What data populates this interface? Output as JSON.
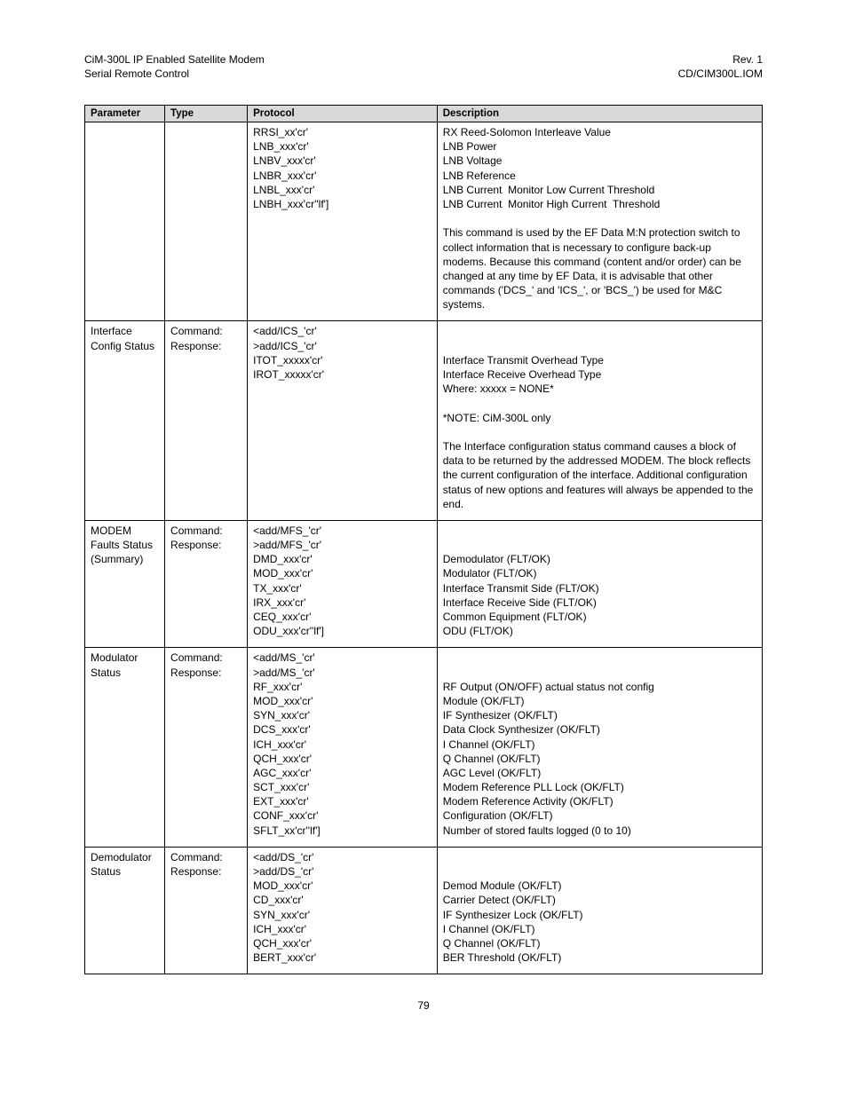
{
  "header": {
    "left1": "CiM-300L IP Enabled Satellite Modem",
    "right1": "Rev. 1",
    "left2": "Serial Remote Control",
    "right2": "CD/CIM300L.IOM"
  },
  "columns": [
    "Parameter",
    "Type",
    "Protocol",
    "Description"
  ],
  "rows": [
    {
      "parameter": [
        ""
      ],
      "type": [
        ""
      ],
      "protocol": [
        "RRSI_xx'cr'",
        "LNB_xxx'cr'",
        "LNBV_xxx'cr'",
        "LNBR_xxx'cr'",
        "LNBL_xxx'cr'",
        "LNBH_xxx'cr''lf']"
      ],
      "description": [
        "RX Reed-Solomon Interleave Value",
        "LNB Power",
        "LNB Voltage",
        "LNB Reference",
        "LNB Current  Monitor Low Current Threshold",
        "LNB Current  Monitor High Current  Threshold",
        "",
        "This command is used by the EF Data M:N protection switch to collect information that is necessary to configure back-up modems. Because this command (content and/or order) can be changed at any time by EF Data, it is advisable that other commands ('DCS_' and 'ICS_', or 'BCS_') be used for M&C systems."
      ]
    },
    {
      "parameter": [
        "Interface Config Status"
      ],
      "type": [
        "Command:",
        "Response:"
      ],
      "protocol": [
        "<add/ICS_'cr'",
        ">add/ICS_'cr'",
        "ITOT_xxxxx'cr'",
        "IROT_xxxxx'cr'"
      ],
      "description": [
        "",
        "",
        "Interface Transmit Overhead Type",
        "Interface Receive Overhead Type",
        "Where: xxxxx = NONE*",
        "",
        "*NOTE: CiM-300L only",
        "",
        "The Interface configuration status command causes a block of data to be returned by the addressed MODEM. The block reflects the current configuration of the interface. Additional configuration status of new options and features will always be appended to the end."
      ]
    },
    {
      "parameter": [
        "MODEM Faults Status (Summary)"
      ],
      "type": [
        "Command:",
        "Response:"
      ],
      "protocol": [
        "<add/MFS_'cr'",
        ">add/MFS_'cr'",
        "DMD_xxx'cr'",
        "MOD_xxx'cr'",
        "TX_xxx'cr'",
        "IRX_xxx'cr'",
        "CEQ_xxx'cr'",
        "ODU_xxx'cr''lf']"
      ],
      "description": [
        "",
        "",
        "Demodulator (FLT/OK)",
        "Modulator (FLT/OK)",
        "Interface Transmit Side (FLT/OK)",
        "Interface Receive Side (FLT/OK)",
        "Common Equipment (FLT/OK)",
        "ODU (FLT/OK)"
      ]
    },
    {
      "parameter": [
        "Modulator Status"
      ],
      "type": [
        "Command:",
        "Response:"
      ],
      "protocol": [
        "<add/MS_'cr'",
        ">add/MS_'cr'",
        "RF_xxx'cr'",
        "MOD_xxx'cr'",
        "SYN_xxx'cr'",
        "DCS_xxx'cr'",
        "ICH_xxx'cr'",
        "QCH_xxx'cr'",
        "AGC_xxx'cr'",
        "SCT_xxx'cr'",
        "EXT_xxx'cr'",
        "CONF_xxx'cr'",
        "SFLT_xx'cr''lf']"
      ],
      "description": [
        "",
        "",
        "RF Output (ON/OFF) actual status not config",
        "Module (OK/FLT)",
        "IF Synthesizer (OK/FLT)",
        "Data Clock Synthesizer (OK/FLT)",
        "I Channel (OK/FLT)",
        "Q Channel (OK/FLT)",
        "AGC Level (OK/FLT)",
        "Modem Reference PLL Lock (OK/FLT)",
        "Modem Reference Activity (OK/FLT)",
        "Configuration (OK/FLT)",
        "Number of stored faults logged (0 to 10)"
      ]
    },
    {
      "parameter": [
        "Demodulator Status"
      ],
      "type": [
        "Command:",
        "Response:"
      ],
      "protocol": [
        "<add/DS_'cr'",
        ">add/DS_'cr'",
        "MOD_xxx'cr'",
        "CD_xxx'cr'",
        "SYN_xxx'cr'",
        "ICH_xxx'cr'",
        "QCH_xxx'cr'",
        "BERT_xxx'cr'"
      ],
      "description": [
        "",
        "",
        "Demod Module (OK/FLT)",
        "Carrier Detect (OK/FLT)",
        "IF Synthesizer Lock (OK/FLT)",
        "I Channel (OK/FLT)",
        "Q Channel (OK/FLT)",
        "BER Threshold (OK/FLT)"
      ]
    }
  ],
  "pageNumber": "79"
}
